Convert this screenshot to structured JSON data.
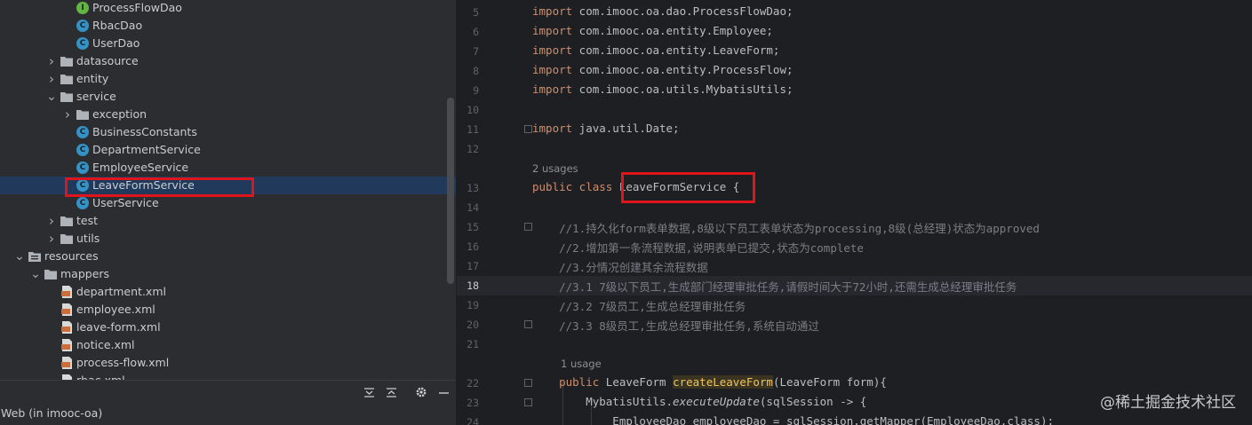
{
  "tree": {
    "items": [
      {
        "label": "ProcessFlowDao",
        "icon": "interface-icon",
        "indent": 90,
        "chevron": ""
      },
      {
        "label": "RbacDao",
        "icon": "class-icon",
        "indent": 90,
        "chevron": ""
      },
      {
        "label": "UserDao",
        "icon": "class-icon",
        "indent": 90,
        "chevron": ""
      },
      {
        "label": "datasource",
        "icon": "folder-icon",
        "indent": 72,
        "chevron": "right"
      },
      {
        "label": "entity",
        "icon": "folder-icon",
        "indent": 72,
        "chevron": "right"
      },
      {
        "label": "service",
        "icon": "folder-icon",
        "indent": 72,
        "chevron": "down"
      },
      {
        "label": "exception",
        "icon": "folder-icon",
        "indent": 90,
        "chevron": "right"
      },
      {
        "label": "BusinessConstants",
        "icon": "class-icon",
        "indent": 90,
        "chevron": ""
      },
      {
        "label": "DepartmentService",
        "icon": "class-icon",
        "indent": 90,
        "chevron": ""
      },
      {
        "label": "EmployeeService",
        "icon": "class-icon",
        "indent": 90,
        "chevron": ""
      },
      {
        "label": "LeaveFormService",
        "icon": "class-icon",
        "indent": 90,
        "chevron": "",
        "selected": true
      },
      {
        "label": "UserService",
        "icon": "class-icon",
        "indent": 90,
        "chevron": ""
      },
      {
        "label": "test",
        "icon": "folder-icon",
        "indent": 72,
        "chevron": "right"
      },
      {
        "label": "utils",
        "icon": "folder-icon",
        "indent": 72,
        "chevron": "right"
      },
      {
        "label": "resources",
        "icon": "resources-folder-icon",
        "indent": 36,
        "chevron": "down"
      },
      {
        "label": "mappers",
        "icon": "folder-icon",
        "indent": 54,
        "chevron": "down"
      },
      {
        "label": "department.xml",
        "icon": "xml-file-icon",
        "indent": 72,
        "chevron": ""
      },
      {
        "label": "employee.xml",
        "icon": "xml-file-icon",
        "indent": 72,
        "chevron": ""
      },
      {
        "label": "leave-form.xml",
        "icon": "xml-file-icon",
        "indent": 72,
        "chevron": ""
      },
      {
        "label": "notice.xml",
        "icon": "xml-file-icon",
        "indent": 72,
        "chevron": ""
      },
      {
        "label": "process-flow.xml",
        "icon": "xml-file-icon",
        "indent": 72,
        "chevron": ""
      },
      {
        "label": "rbac.xml",
        "icon": "xml-file-icon",
        "indent": 72,
        "chevron": ""
      }
    ],
    "toolbar_icons": [
      "expand-all-icon",
      "collapse-all-icon",
      "gear-icon",
      "minimize-icon"
    ],
    "status": "Web (in imooc-oa)"
  },
  "editor": {
    "current_line": "18",
    "lines": [
      {
        "num": "5",
        "text": "import com.imooc.oa.dao.ProcessFlowDao;"
      },
      {
        "num": "6",
        "text": "import com.imooc.oa.entity.Employee;"
      },
      {
        "num": "7",
        "text": "import com.imooc.oa.entity.LeaveForm;"
      },
      {
        "num": "8",
        "text": "import com.imooc.oa.entity.ProcessFlow;"
      },
      {
        "num": "9",
        "text": "import com.imooc.oa.utils.MybatisUtils;"
      },
      {
        "num": "10",
        "text": ""
      },
      {
        "num": "11",
        "text": "import java.util.Date;"
      },
      {
        "num": "12",
        "text": ""
      },
      {
        "num": "13",
        "text": "public class LeaveFormService {"
      },
      {
        "num": "14",
        "text": ""
      },
      {
        "num": "15",
        "text": "    //1.持久化form表单数据,8级以下员工表单状态为processing,8级(总经理)状态为approved"
      },
      {
        "num": "16",
        "text": "    //2.增加第一条流程数据,说明表单已提交,状态为complete"
      },
      {
        "num": "17",
        "text": "    //3.分情况创建其余流程数据"
      },
      {
        "num": "18",
        "text": "    //3.1 7级以下员工,生成部门经理审批任务,请假时间大于72小时,还需生成总经理审批任务"
      },
      {
        "num": "19",
        "text": "    //3.2 7级员工,生成总经理审批任务"
      },
      {
        "num": "20",
        "text": "    //3.3 8级员工,生成总经理审批任务,系统自动通过"
      },
      {
        "num": "21",
        "text": ""
      },
      {
        "num": "22",
        "text": "    public LeaveForm createLeaveForm(LeaveForm form){"
      },
      {
        "num": "23",
        "text": "        MybatisUtils.executeUpdate(sqlSession -> {"
      },
      {
        "num": "24",
        "text": "            EmployeeDao employeeDao = sqlSession.getMapper(EmployeeDao.class);"
      }
    ],
    "usages": [
      "2 usages",
      "1 usage"
    ],
    "tokens": {
      "kw_import": "import",
      "kw_public": "public",
      "kw_class": "class",
      "class_name": "LeaveFormService",
      "brace": " {",
      "return_type": "LeaveForm",
      "method_name": "createLeaveForm",
      "method_params": "(LeaveForm form){",
      "util_class": "MybatisUtils.",
      "util_method": "executeUpdate",
      "util_args": "(sqlSession -> {",
      "line24": "EmployeeDao employeeDao = sqlSession.getMapper(EmployeeDao.class);"
    }
  },
  "watermark": "@稀土掘金技术社区",
  "colors": {
    "highlight_box": "#e0141b",
    "selection": "#213a5c",
    "keyword": "#cf8e6d",
    "comment": "#7a7e85"
  }
}
